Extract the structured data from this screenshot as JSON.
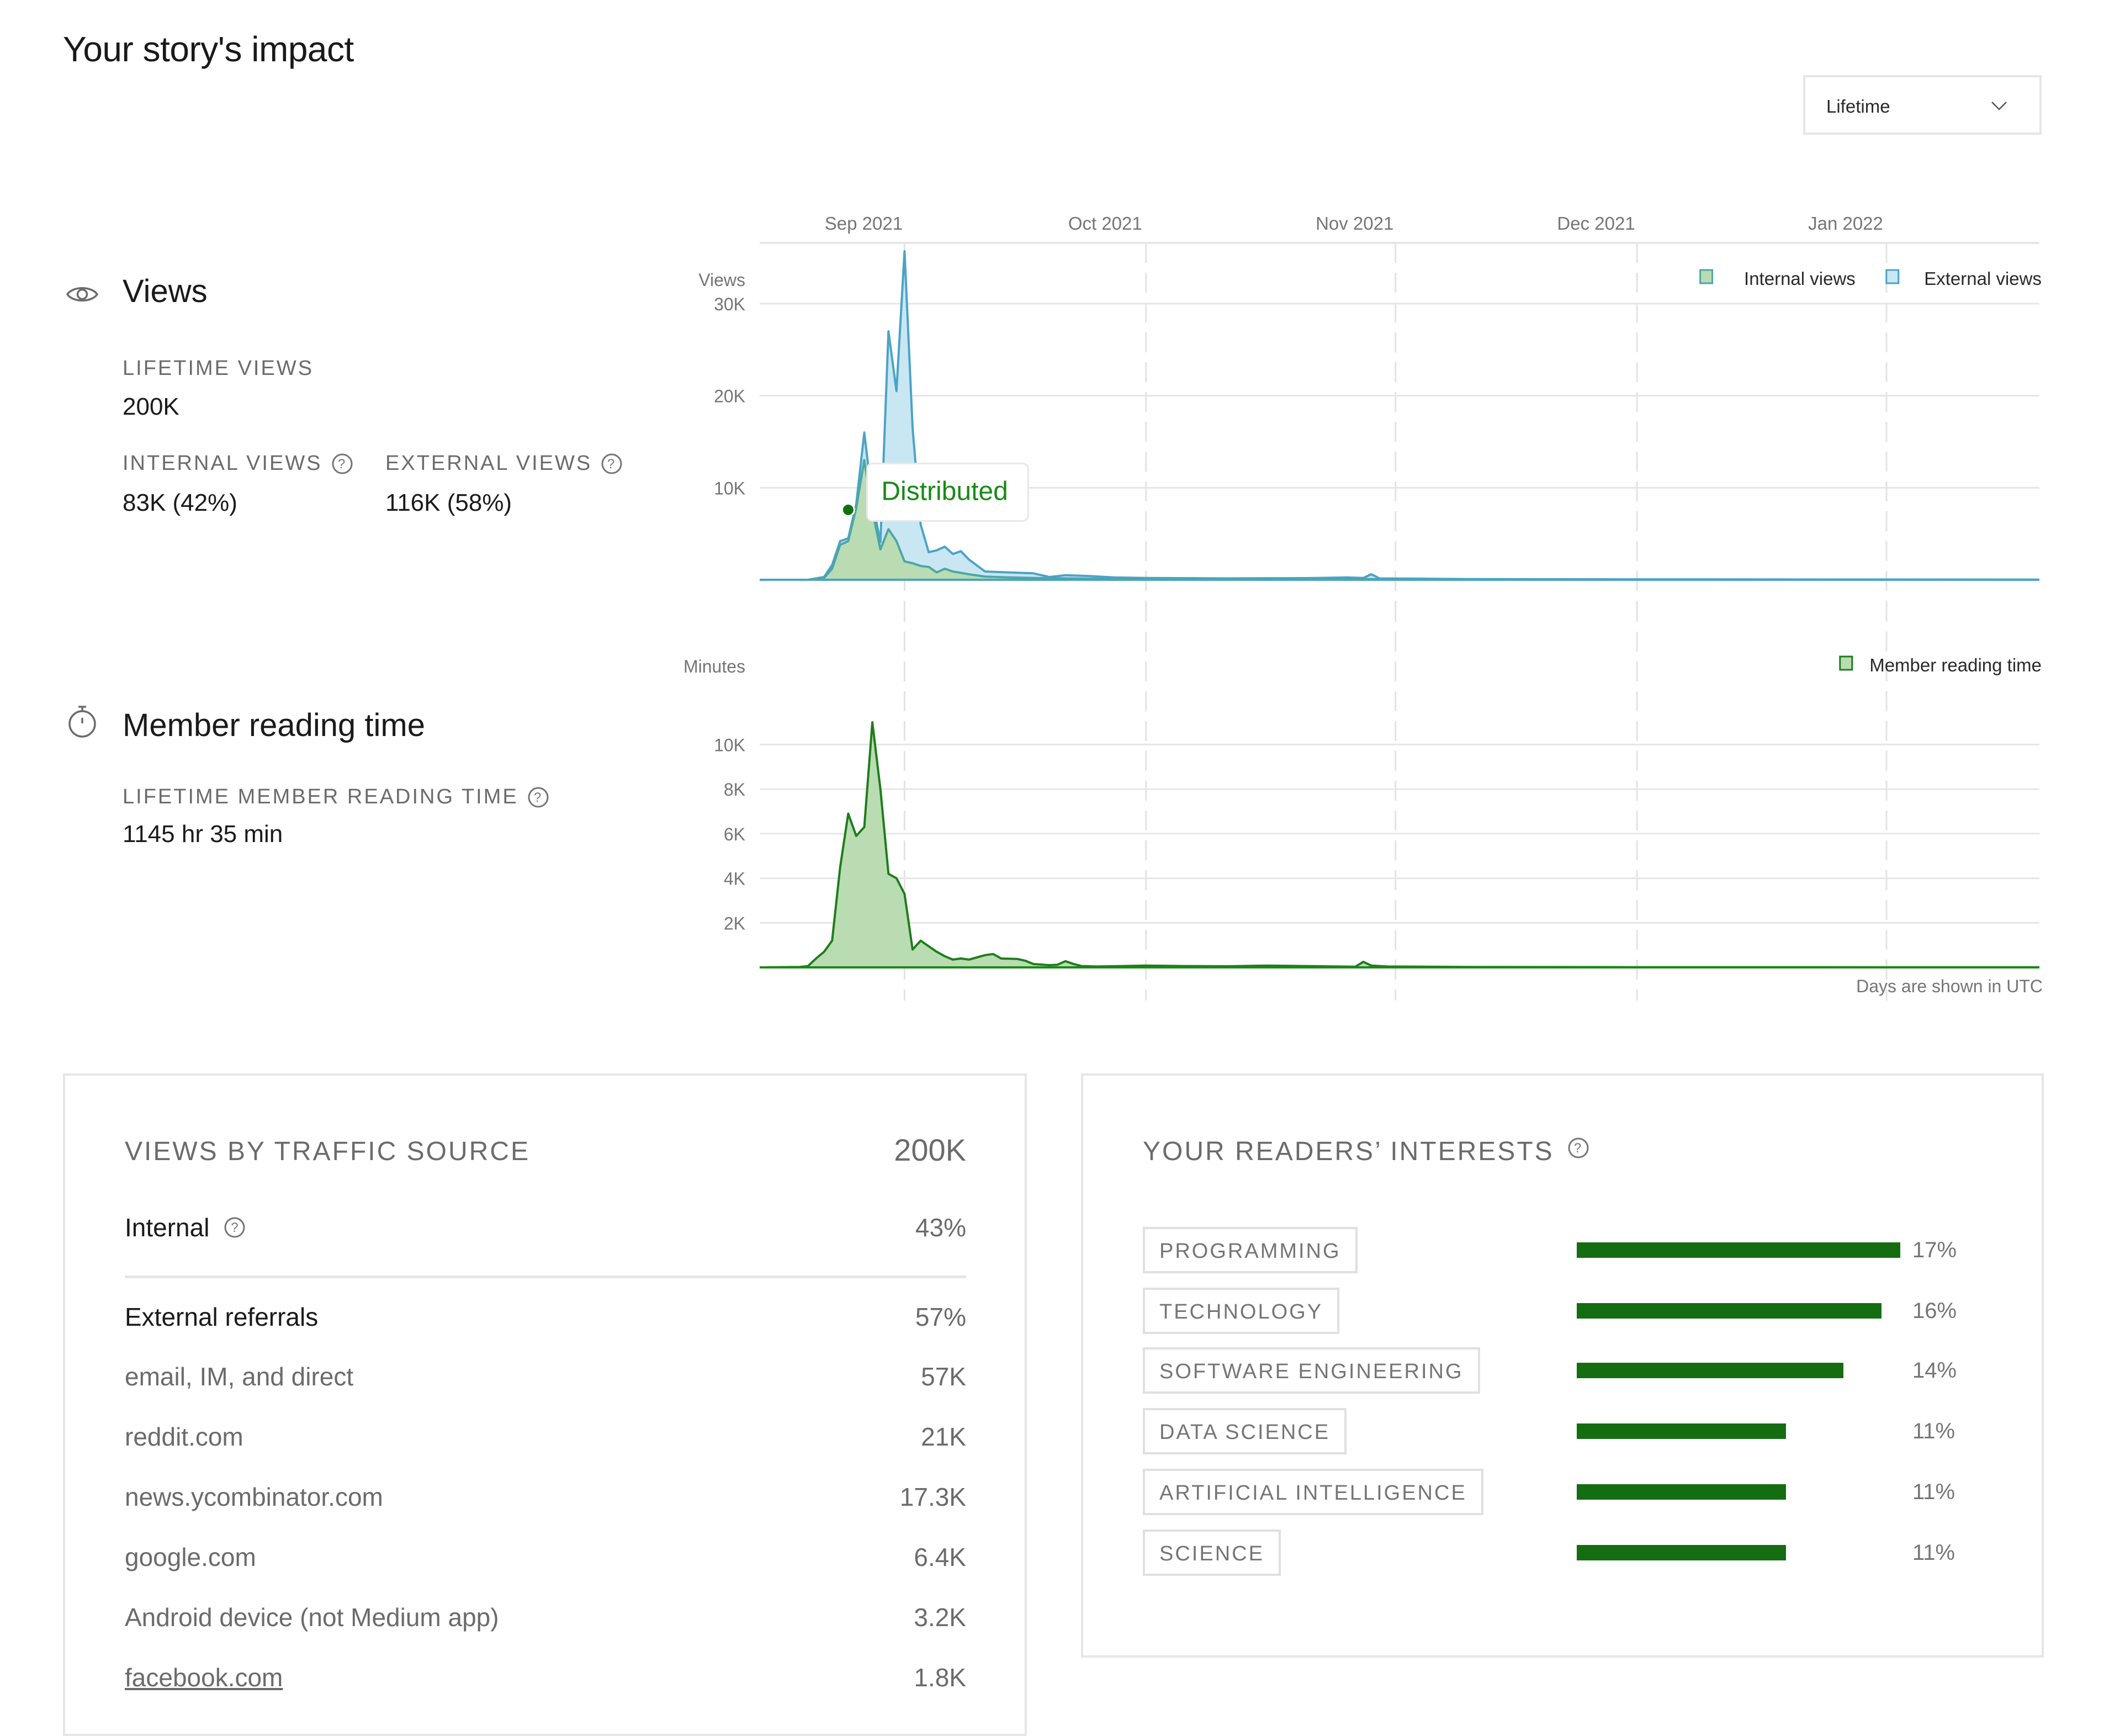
{
  "page": {
    "title": "Your story's impact",
    "period_select": {
      "selected": "Lifetime",
      "icon": "chevron-down-icon"
    }
  },
  "views": {
    "heading": "Views",
    "icon": "eye-icon",
    "lifetime_label": "LIFETIME VIEWS",
    "lifetime_value": "200K",
    "internal_label": "INTERNAL VIEWS",
    "internal_value": "83K (42%)",
    "external_label": "EXTERNAL VIEWS",
    "external_value": "116K (58%)"
  },
  "reading": {
    "heading": "Member reading time",
    "icon": "stopwatch-icon",
    "lifetime_label": "LIFETIME MEMBER READING TIME",
    "lifetime_value": "1145 hr 35 min"
  },
  "chart_note": "Days are shown in UTC",
  "colors": {
    "internal": "#1a8917",
    "internal_fill": "#b9dcb3",
    "external": "#4ba3c7",
    "external_fill": "#c9e7f3",
    "bar": "#156d12"
  },
  "chart_data": [
    {
      "type": "area",
      "title": "Views",
      "ylabel": "Views",
      "x_tick_labels": [
        "Sep 2021",
        "Oct 2021",
        "Nov 2021",
        "Dec 2021",
        "Jan 2022"
      ],
      "x_tick_days": [
        0,
        30,
        61,
        91,
        122
      ],
      "x_range_days": [
        -18,
        141
      ],
      "y_ticks": [
        10000,
        20000,
        30000
      ],
      "y_tick_labels": [
        "10K",
        "20K",
        "30K"
      ],
      "ylim": [
        0,
        36000
      ],
      "grid": true,
      "legend_position": "top-right",
      "annotation": {
        "label": "Distributed",
        "day": -7,
        "value": 7600
      },
      "series": [
        {
          "name": "Internal views",
          "stacked_totals": true,
          "points": [
            [
              -18,
              0
            ],
            [
              -12,
              0
            ],
            [
              -10,
              200
            ],
            [
              -9,
              1200
            ],
            [
              -8,
              3800
            ],
            [
              -7,
              4200
            ],
            [
              -6,
              7800
            ],
            [
              -5,
              13000
            ],
            [
              -4,
              7500
            ],
            [
              -3,
              3300
            ],
            [
              -2,
              5500
            ],
            [
              -1,
              4200
            ],
            [
              0,
              2000
            ],
            [
              1,
              1800
            ],
            [
              2,
              1500
            ],
            [
              3,
              1400
            ],
            [
              4,
              800
            ],
            [
              5,
              1200
            ],
            [
              6,
              900
            ],
            [
              8,
              600
            ],
            [
              10,
              350
            ],
            [
              13,
              250
            ],
            [
              16,
              200
            ],
            [
              20,
              150
            ],
            [
              25,
              100
            ],
            [
              30,
              80
            ],
            [
              40,
              60
            ],
            [
              50,
              80
            ],
            [
              55,
              120
            ],
            [
              60,
              50
            ],
            [
              70,
              40
            ],
            [
              80,
              30
            ],
            [
              90,
              20
            ],
            [
              100,
              15
            ],
            [
              120,
              10
            ],
            [
              141,
              5
            ]
          ]
        },
        {
          "name": "External views",
          "stacked_totals": true,
          "points": [
            [
              -18,
              0
            ],
            [
              -12,
              0
            ],
            [
              -10,
              300
            ],
            [
              -9,
              1600
            ],
            [
              -8,
              4200
            ],
            [
              -7,
              4500
            ],
            [
              -6,
              8200
            ],
            [
              -5,
              16000
            ],
            [
              -4,
              8500
            ],
            [
              -3,
              4100
            ],
            [
              -2,
              27000
            ],
            [
              -1,
              20500
            ],
            [
              0,
              35700
            ],
            [
              1,
              16500
            ],
            [
              2,
              6000
            ],
            [
              3,
              3000
            ],
            [
              4,
              3200
            ],
            [
              5,
              3600
            ],
            [
              6,
              2800
            ],
            [
              7,
              3100
            ],
            [
              8,
              2200
            ],
            [
              10,
              900
            ],
            [
              13,
              800
            ],
            [
              16,
              700
            ],
            [
              18,
              300
            ],
            [
              20,
              500
            ],
            [
              23,
              400
            ],
            [
              26,
              250
            ],
            [
              30,
              200
            ],
            [
              40,
              150
            ],
            [
              50,
              180
            ],
            [
              55,
              250
            ],
            [
              57,
              200
            ],
            [
              58,
              600
            ],
            [
              59,
              150
            ],
            [
              70,
              80
            ],
            [
              80,
              60
            ],
            [
              90,
              50
            ],
            [
              100,
              40
            ],
            [
              120,
              30
            ],
            [
              141,
              20
            ]
          ]
        }
      ]
    },
    {
      "type": "area",
      "title": "Member reading time",
      "ylabel": "Minutes",
      "x_tick_days": [
        0,
        30,
        61,
        91,
        122
      ],
      "x_range_days": [
        -18,
        141
      ],
      "y_ticks": [
        2000,
        4000,
        6000,
        8000,
        10000
      ],
      "y_tick_labels": [
        "2K",
        "4K",
        "6K",
        "8K",
        "10K"
      ],
      "ylim": [
        0,
        11200
      ],
      "grid": true,
      "legend_position": "top-right",
      "series": [
        {
          "name": "Member reading time",
          "points": [
            [
              -18,
              0
            ],
            [
              -13,
              20
            ],
            [
              -12,
              60
            ],
            [
              -11,
              400
            ],
            [
              -10,
              700
            ],
            [
              -9,
              1200
            ],
            [
              -8,
              4500
            ],
            [
              -7,
              6900
            ],
            [
              -6,
              5900
            ],
            [
              -5,
              6300
            ],
            [
              -4,
              11000
            ],
            [
              -3,
              8000
            ],
            [
              -2,
              4200
            ],
            [
              -1,
              4000
            ],
            [
              0,
              3300
            ],
            [
              1,
              800
            ],
            [
              2,
              1200
            ],
            [
              4,
              700
            ],
            [
              5,
              500
            ],
            [
              6,
              350
            ],
            [
              7,
              400
            ],
            [
              8,
              350
            ],
            [
              10,
              550
            ],
            [
              11,
              600
            ],
            [
              12,
              400
            ],
            [
              14,
              380
            ],
            [
              15,
              300
            ],
            [
              16,
              150
            ],
            [
              18,
              100
            ],
            [
              19,
              120
            ],
            [
              20,
              280
            ],
            [
              21,
              150
            ],
            [
              22,
              60
            ],
            [
              24,
              40
            ],
            [
              30,
              80
            ],
            [
              35,
              60
            ],
            [
              40,
              50
            ],
            [
              45,
              80
            ],
            [
              50,
              60
            ],
            [
              56,
              30
            ],
            [
              57,
              250
            ],
            [
              58,
              80
            ],
            [
              60,
              40
            ],
            [
              70,
              20
            ],
            [
              80,
              15
            ],
            [
              90,
              10
            ],
            [
              100,
              10
            ],
            [
              120,
              8
            ],
            [
              141,
              5
            ]
          ]
        }
      ]
    },
    {
      "type": "bar",
      "title": "YOUR READERS' INTERESTS",
      "categories": [
        "PROGRAMMING",
        "TECHNOLOGY",
        "SOFTWARE ENGINEERING",
        "DATA SCIENCE",
        "ARTIFICIAL INTELLIGENCE",
        "SCIENCE"
      ],
      "values": [
        17,
        16,
        14,
        11,
        11,
        11
      ],
      "value_labels": [
        "17%",
        "16%",
        "14%",
        "11%",
        "11%",
        "11%"
      ],
      "xlim": [
        0,
        17
      ]
    }
  ],
  "traffic": {
    "heading": "VIEWS BY TRAFFIC SOURCE",
    "total": "200K",
    "internal": {
      "label": "Internal",
      "value": "43%"
    },
    "external": {
      "label": "External referrals",
      "value": "57%"
    },
    "sources": [
      {
        "label": "email, IM, and direct",
        "value": "57K"
      },
      {
        "label": "reddit.com",
        "value": "21K"
      },
      {
        "label": "news.ycombinator.com",
        "value": "17.3K"
      },
      {
        "label": "google.com",
        "value": "6.4K"
      },
      {
        "label": "Android device (not Medium app)",
        "value": "3.2K"
      },
      {
        "label": "facebook.com",
        "value": "1.8K",
        "link": true
      }
    ]
  },
  "interests": {
    "heading": "YOUR READERS’ INTERESTS"
  }
}
